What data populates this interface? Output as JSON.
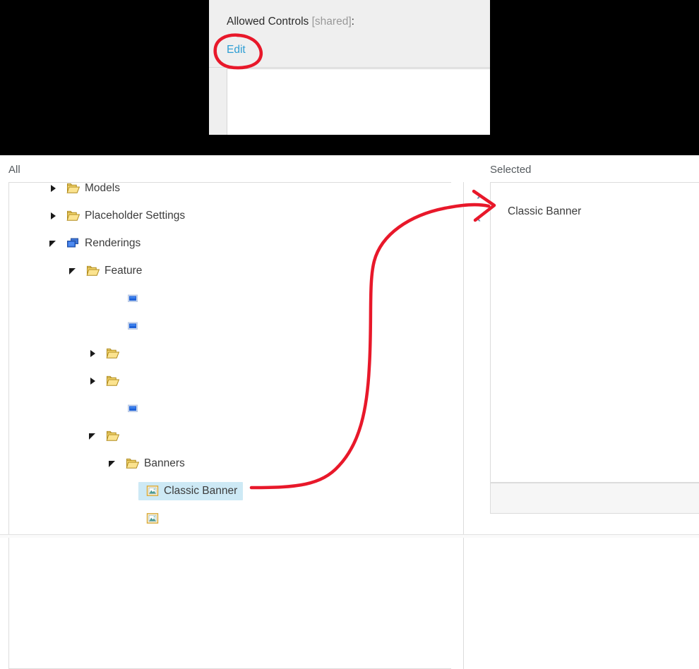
{
  "field_panel": {
    "label": "Allowed Controls",
    "shared_tag": "[shared]",
    "colon": ":",
    "edit_link": "Edit",
    "value": ""
  },
  "selector": {
    "all_heading": "All",
    "selected_heading": "Selected",
    "add_button": "›",
    "remove_button": "‹",
    "selected_items": [
      "Classic Banner"
    ]
  },
  "tree": {
    "nodes": [
      {
        "label": "Models",
        "indent": 0,
        "state": "collapsed",
        "icon": "folder-icon",
        "selected": false,
        "clipped": "top"
      },
      {
        "label": "Placeholder Settings",
        "indent": 0,
        "state": "collapsed",
        "icon": "folder-icon",
        "selected": false
      },
      {
        "label": "Renderings",
        "indent": 0,
        "state": "expanded",
        "icon": "renderings-icon",
        "selected": false
      },
      {
        "label": "Feature",
        "indent": 1,
        "state": "expanded",
        "icon": "folder-icon",
        "selected": false
      },
      {
        "label": "",
        "indent": 3,
        "state": "leaf",
        "icon": "rendering-item-icon",
        "selected": false
      },
      {
        "label": "",
        "indent": 3,
        "state": "leaf",
        "icon": "rendering-item-icon",
        "selected": false
      },
      {
        "label": "",
        "indent": 2,
        "state": "collapsed",
        "icon": "folder-icon",
        "selected": false
      },
      {
        "label": "",
        "indent": 2,
        "state": "collapsed",
        "icon": "folder-icon",
        "selected": false
      },
      {
        "label": "",
        "indent": 3,
        "state": "leaf",
        "icon": "rendering-item-icon",
        "selected": false
      },
      {
        "label": "",
        "indent": 2,
        "state": "expanded",
        "icon": "folder-icon",
        "selected": false
      },
      {
        "label": "Banners",
        "indent": 3,
        "state": "expanded",
        "icon": "folder-icon",
        "selected": false
      },
      {
        "label": "Classic Banner",
        "indent": 4,
        "state": "leaf",
        "icon": "image-item-icon",
        "selected": true
      },
      {
        "label": "",
        "indent": 4,
        "state": "leaf",
        "icon": "image-item-icon",
        "selected": false,
        "clipped": "bottom"
      }
    ]
  },
  "annotation": {
    "color": "#e8182a",
    "shapes": [
      "circle-around-edit-link",
      "curved-arrow-from-classic-banner-to-add-button"
    ]
  },
  "colors": {
    "link": "#2e9ed4",
    "panel_bg": "#efefef",
    "selection_highlight": "#cde9f5",
    "transfer_button": "#6c91b4",
    "annotation_red": "#e8182a",
    "muted_text": "#999999"
  }
}
